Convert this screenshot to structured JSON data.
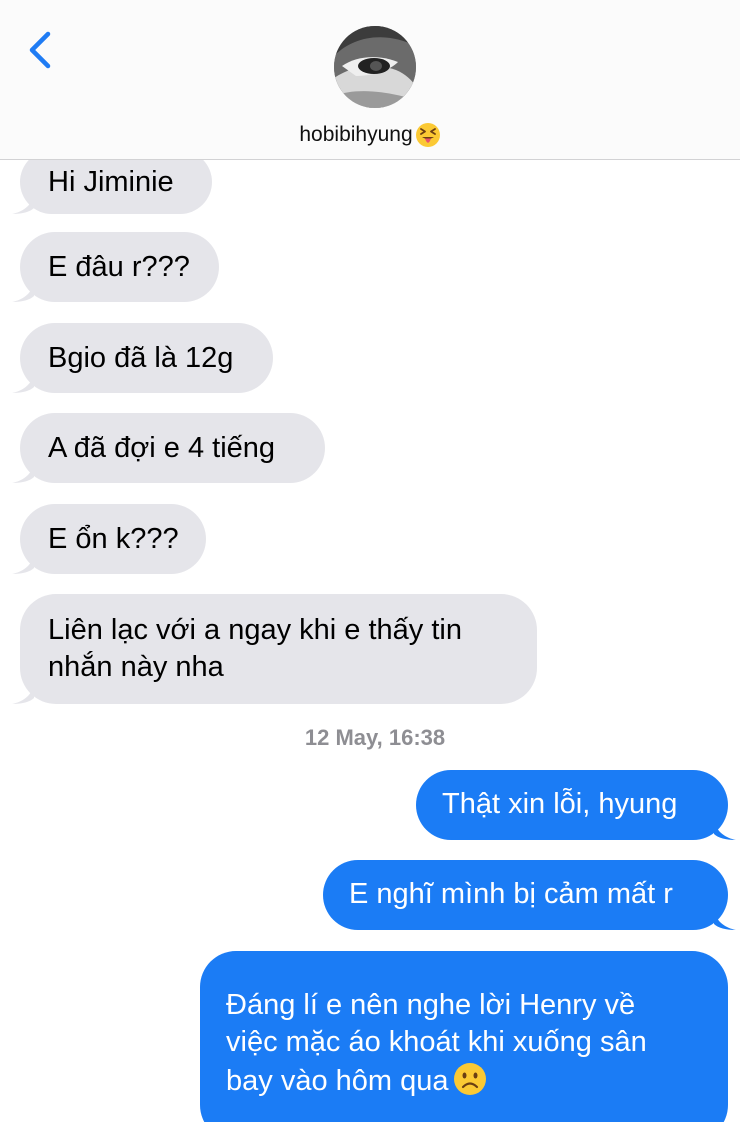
{
  "header": {
    "contact_name": "hobibihyung",
    "name_emoji_icon": "squinting-tongue-face-icon",
    "back_icon": "chevron-left-icon",
    "avatar": "contact-avatar"
  },
  "messages": {
    "m1": "Hi Jiminie",
    "m2": "E đâu r???",
    "m3": "Bgio đã là 12g",
    "m4": "A đã đợi e 4 tiếng",
    "m5": "E ổn k???",
    "m6_line1": "Liên lạc với a ngay khi e thấy tin",
    "m6_line2": "nhắn này nha",
    "timestamp": "12 May, 16:38",
    "o1": "Thật xin lỗi, hyung",
    "o2": "E nghĩ mình bị cảm mất r",
    "o3_line1": "Đáng lí e nên nghe lời Henry về",
    "o3_line2": "việc mặc áo khoát khi xuống sân",
    "o3_line3": "bay vào hôm qua",
    "o3_emoji_icon": "frowning-face-icon"
  },
  "colors": {
    "accent": "#1b7cf5",
    "incoming_bubble": "#e5e5ea",
    "timestamp": "#8e8e93",
    "back_chevron": "#1f7cf4"
  }
}
